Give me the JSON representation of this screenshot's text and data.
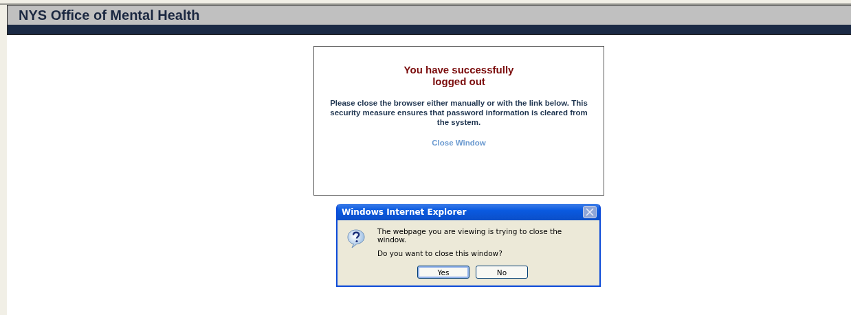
{
  "header": {
    "title": "NYS Office of Mental Health"
  },
  "message": {
    "heading_lines": [
      "You have successfully",
      "logged out"
    ],
    "body": "Please close the browser either manually or with the link below. This security measure ensures that password information is cleared from the system.",
    "link": "Close Window"
  },
  "dialog": {
    "title": "Windows Internet Explorer",
    "lines": [
      "The webpage you are viewing is trying to close the window.",
      "Do you want to close this window?"
    ],
    "buttons": [
      {
        "label": "Yes",
        "focused": true
      },
      {
        "label": "No",
        "focused": false
      }
    ]
  }
}
